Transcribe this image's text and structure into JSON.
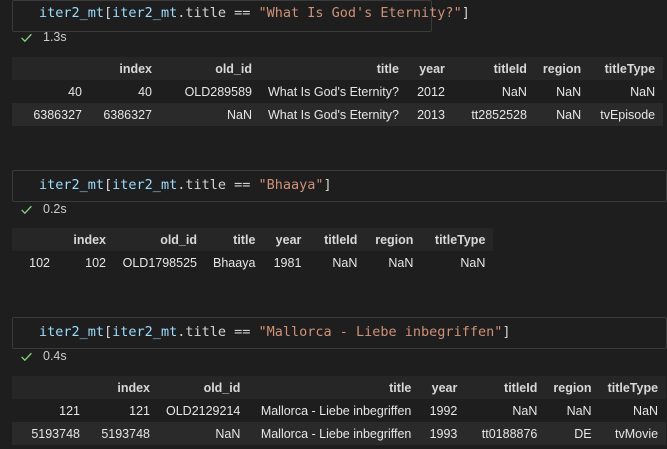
{
  "cells": [
    {
      "code": {
        "var": "iter2_mt",
        "col_var": "iter2_mt",
        "attr": ".title",
        "op": " == ",
        "str": "\"What Is God's Eternity?\""
      },
      "time": "1.3s",
      "columns": [
        "",
        "index",
        "old_id",
        "title",
        "year",
        "titleId",
        "region",
        "titleType"
      ],
      "rows": [
        [
          "40",
          "40",
          "OLD289589",
          "What Is God's Eternity?",
          "2012",
          "NaN",
          "NaN",
          "NaN"
        ],
        [
          "6386327",
          "6386327",
          "NaN",
          "What Is God's Eternity?",
          "2013",
          "tt2852528",
          "NaN",
          "tvEpisode"
        ]
      ]
    },
    {
      "code": {
        "var": "iter2_mt",
        "col_var": "iter2_mt",
        "attr": ".title",
        "op": " == ",
        "str": "\"Bhaaya\""
      },
      "time": "0.2s",
      "columns": [
        "",
        "index",
        "old_id",
        "title",
        "year",
        "titleId",
        "region",
        "titleType"
      ],
      "rows": [
        [
          "102",
          "102",
          "OLD1798525",
          "Bhaaya",
          "1981",
          "NaN",
          "NaN",
          "NaN"
        ]
      ]
    },
    {
      "code": {
        "var": "iter2_mt",
        "col_var": "iter2_mt",
        "attr": ".title",
        "op": " == ",
        "str": "\"Mallorca - Liebe inbegriffen\""
      },
      "time": "0.4s",
      "columns": [
        "",
        "index",
        "old_id",
        "title",
        "year",
        "titleId",
        "region",
        "titleType"
      ],
      "rows": [
        [
          "121",
          "121",
          "OLD2129214",
          "Mallorca - Liebe inbegriffen",
          "1992",
          "NaN",
          "NaN",
          "NaN"
        ],
        [
          "5193748",
          "5193748",
          "NaN",
          "Mallorca - Liebe inbegriffen",
          "1993",
          "tt0188876",
          "DE",
          "tvMovie"
        ]
      ]
    }
  ],
  "icons": {
    "success": "checkmark-icon"
  },
  "colors": {
    "check": "#89d185",
    "string": "#ce9178",
    "variable": "#9cdcfe"
  }
}
